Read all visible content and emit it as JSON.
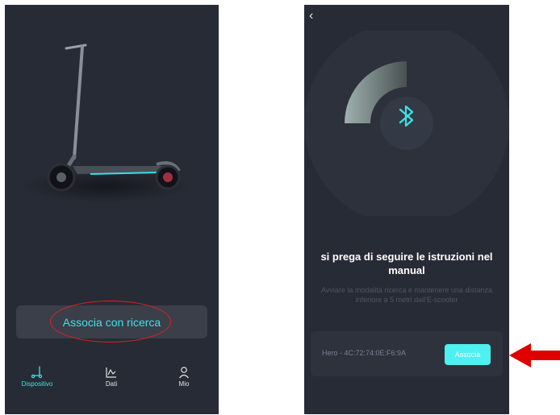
{
  "left_screen": {
    "pair_button_label": "Associa con ricerca",
    "nav": [
      {
        "label": "Dispositivo",
        "icon": "scooter-icon",
        "active": true
      },
      {
        "label": "Dati",
        "icon": "chart-icon",
        "active": false
      },
      {
        "label": "Mio",
        "icon": "user-icon",
        "active": false
      }
    ]
  },
  "right_screen": {
    "back_icon": "‹",
    "title": "si prega di seguire le istruzioni nel manual",
    "subtitle": "Avviare la modalità ricerca e mantenere una distanza inferiore a 5 metri dall'E-scooter",
    "device_name": "Hero - 4C:72:74:0E:F6:9A",
    "associa_label": "Associa"
  },
  "colors": {
    "background": "#272b35",
    "accent": "#3de3e3",
    "annotation_red": "#e02020"
  }
}
